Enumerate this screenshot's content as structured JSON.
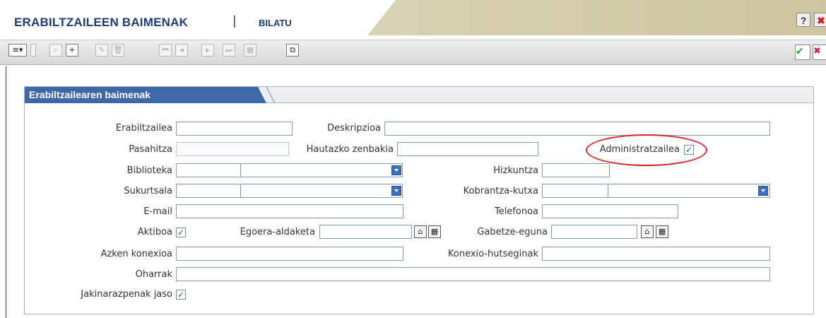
{
  "header": {
    "title": "ERABILTZAILEEN BAIMENAK",
    "separator": "|",
    "mode": "BILATU",
    "help_label": "?",
    "close_label": "✖"
  },
  "toolbar": {
    "icons": [
      "list-menu-icon",
      "search-icon",
      "add-icon",
      "edit-icon",
      "delete-icon",
      "first-record-icon",
      "prev-record-icon",
      "next-record-icon",
      "last-record-icon",
      "grid-icon",
      "copy-icon",
      "accept-icon",
      "cancel-icon"
    ],
    "add_label": "+",
    "accept_label": "✔",
    "cancel_label": "✖"
  },
  "panel": {
    "title": "Erabiltzailearen baimenak"
  },
  "form": {
    "erabiltzailea": {
      "label": "Erabiltzailea",
      "value": ""
    },
    "deskripzioa": {
      "label": "Deskripzioa",
      "value": ""
    },
    "pasahitza": {
      "label": "Pasahitza",
      "value": ""
    },
    "hautazko_zenbakia": {
      "label": "Hautazko zenbakia",
      "value": ""
    },
    "administratzailea": {
      "label": "Administratzailea",
      "checked": true
    },
    "biblioteka": {
      "label": "Biblioteka",
      "code": "",
      "value": ""
    },
    "hizkuntza": {
      "label": "Hizkuntza",
      "value": ""
    },
    "sukurtsala": {
      "label": "Sukurtsala",
      "code": "",
      "value": ""
    },
    "kobrantza_kutxa": {
      "label": "Kobrantza-kutxa",
      "code": "",
      "value": ""
    },
    "email": {
      "label": "E-mail",
      "value": ""
    },
    "telefonoa": {
      "label": "Telefonoa",
      "value": ""
    },
    "aktiboa": {
      "label": "Aktiboa",
      "checked": true
    },
    "egoera_aldaketa": {
      "label": "Egoera-aldaketa",
      "value": ""
    },
    "gabetze_eguna": {
      "label": "Gabetze-eguna",
      "value": ""
    },
    "azken_konexioa": {
      "label": "Azken konexioa",
      "value": ""
    },
    "konexio_hutseginak": {
      "label": "Konexio-hutseginak",
      "value": ""
    },
    "oharrak": {
      "label": "Oharrak",
      "value": ""
    },
    "jakinarazpenak_jaso": {
      "label": "Jakinarazpenak jaso",
      "checked": true
    }
  },
  "colors": {
    "title_blue": "#1c3d7a",
    "panel_tab": "#3f68a8",
    "highlight_red": "#d8222a",
    "checkbox_blue": "#2c5aa0"
  }
}
